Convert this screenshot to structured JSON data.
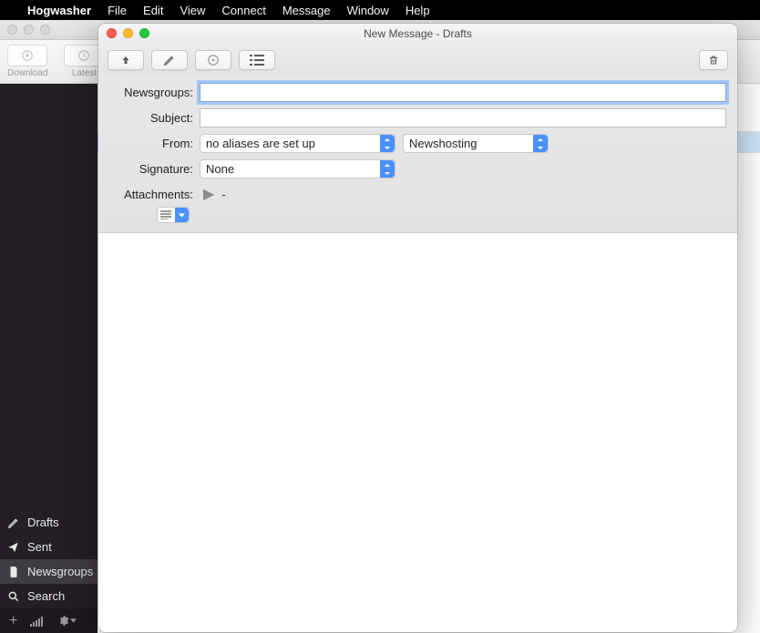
{
  "menubar": {
    "app_name": "Hogwasher",
    "items": [
      "File",
      "Edit",
      "View",
      "Connect",
      "Message",
      "Window",
      "Help"
    ]
  },
  "bg_toolbar": {
    "download_label": "Download",
    "latest_label": "Latest"
  },
  "sidebar": {
    "items": [
      {
        "label": "Drafts",
        "icon": "pencil-icon"
      },
      {
        "label": "Sent",
        "icon": "send-icon"
      },
      {
        "label": "Newsgroups",
        "icon": "file-icon"
      },
      {
        "label": "Search",
        "icon": "search-icon"
      }
    ]
  },
  "window": {
    "title": "New Message - Drafts"
  },
  "form": {
    "newsgroups_label": "Newsgroups:",
    "newsgroups_value": "",
    "subject_label": "Subject:",
    "subject_value": "",
    "from_label": "From:",
    "from_select": "no aliases are set up",
    "server_select": "Newshosting",
    "signature_label": "Signature:",
    "signature_select": "None",
    "attachments_label": "Attachments:",
    "attachments_summary": "-"
  }
}
